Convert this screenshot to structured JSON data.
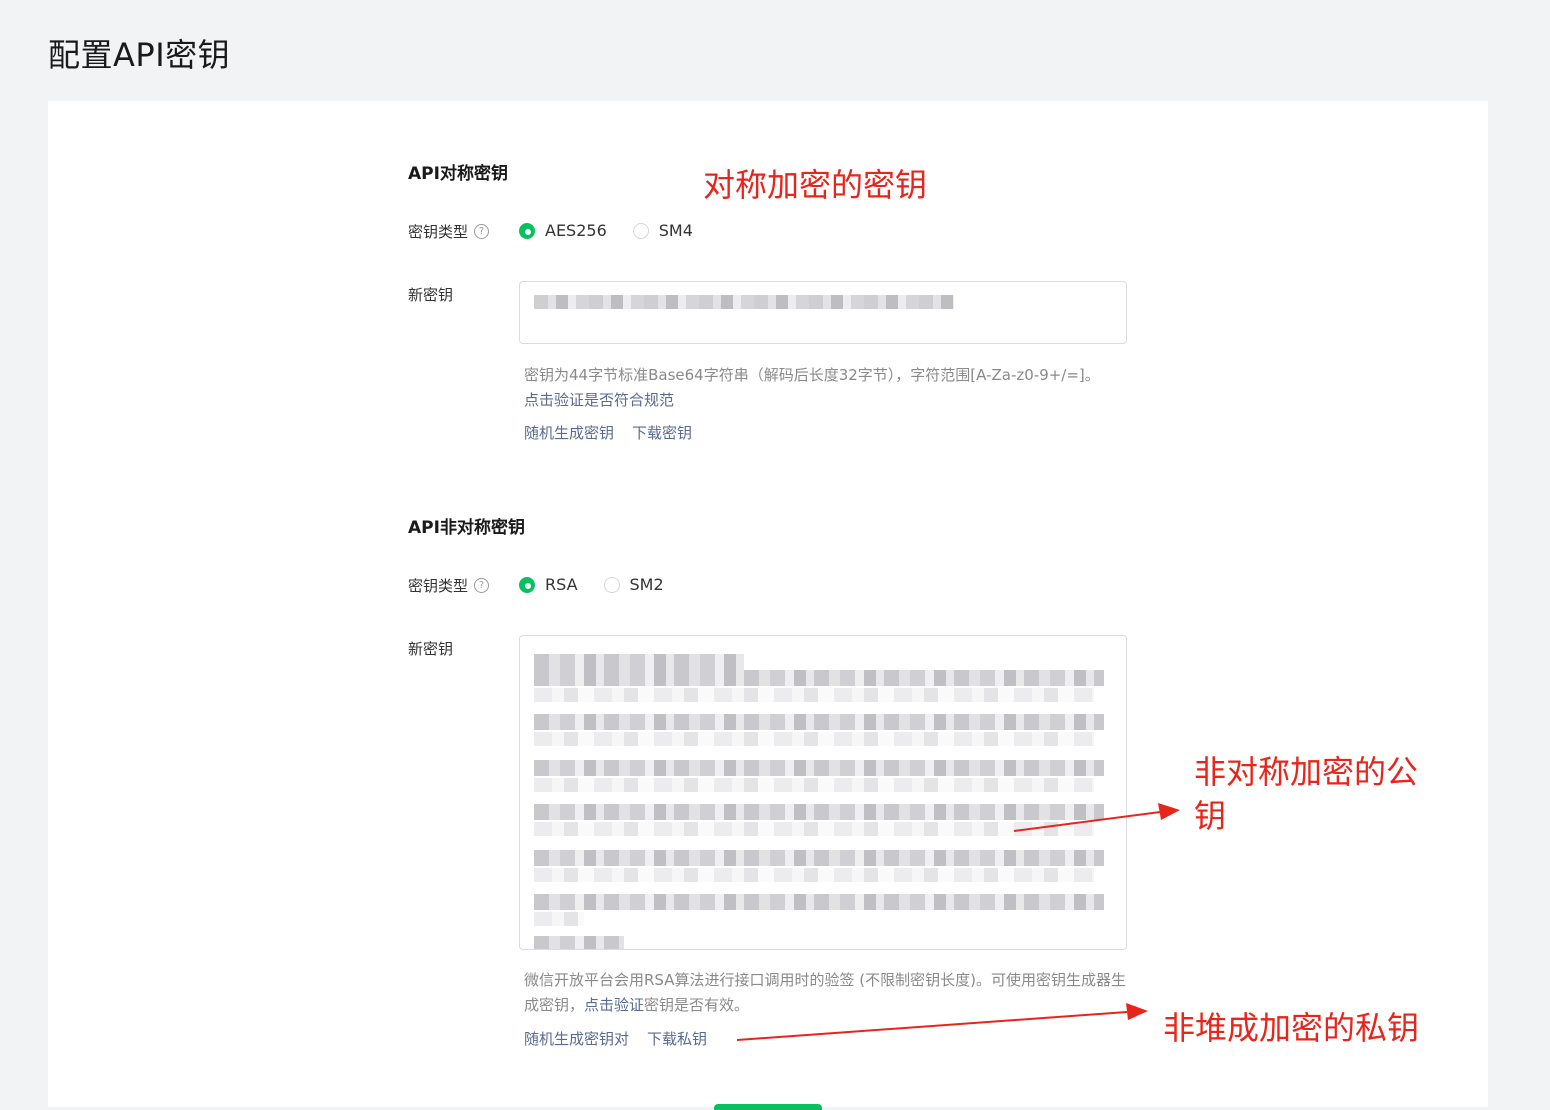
{
  "page": {
    "title": "配置API密钥"
  },
  "symmetric": {
    "title": "API对称密钥",
    "type_label": "密钥类型",
    "options": [
      "AES256",
      "SM4"
    ],
    "selected": "AES256",
    "key_label": "新密钥",
    "hint_text": "密钥为44字节标准Base64字符串（解码后长度32字节），字符范围[A-Za-z0-9+/=]。",
    "hint_link": "点击验证是否符合规范",
    "generate_link": "随机生成密钥",
    "download_link": "下载密钥"
  },
  "asymmetric": {
    "title": "API非对称密钥",
    "type_label": "密钥类型",
    "options": [
      "RSA",
      "SM2"
    ],
    "selected": "RSA",
    "key_label": "新密钥",
    "hint_text_1": "微信开放平台会用RSA算法进行接口调用时的验签 (不限制密钥长度)。可使用密钥生成器生成密钥，",
    "hint_link": "点击验证",
    "hint_text_2": "密钥是否有效。",
    "generate_link": "随机生成密钥对",
    "download_link": "下载私钥"
  },
  "annotations": {
    "symmetric": "对称加密的密钥",
    "public_key": "非对称加密的公钥",
    "private_key": "非堆成加密的私钥"
  },
  "colors": {
    "accent": "#07c160",
    "link": "#576b95",
    "annotation": "#e8251a"
  }
}
